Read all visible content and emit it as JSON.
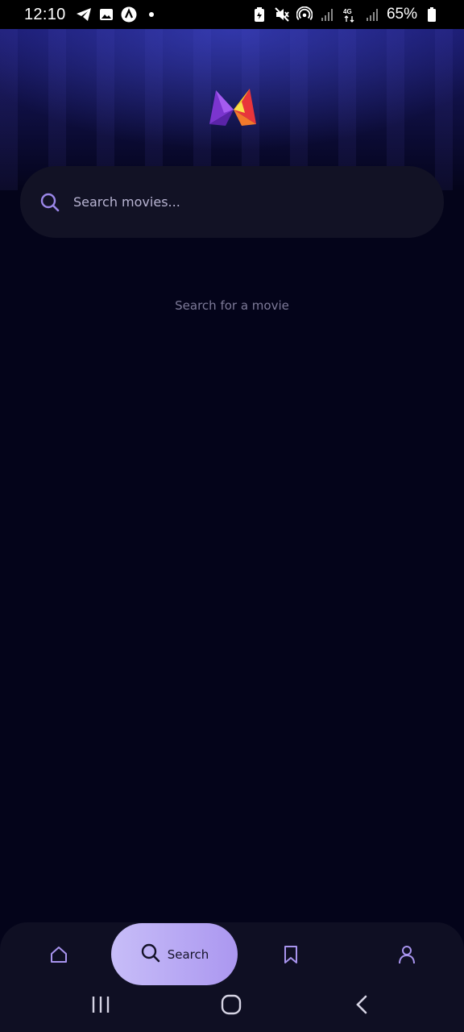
{
  "status_bar": {
    "time": "12:10",
    "battery": "65%",
    "left_icons": [
      "telegram-icon",
      "gallery-icon",
      "app-icon",
      "dot-icon"
    ],
    "right_icons": [
      "battery-saver-icon",
      "mute-icon",
      "hotspot-icon",
      "signal-icon",
      "4g-icon",
      "signal-icon"
    ]
  },
  "colors": {
    "background": "#04041a",
    "search_bar": "#121225",
    "accent": "#b9a6f5",
    "logo_purple": "#8a3fd6",
    "logo_yellow": "#f7d21e",
    "logo_red": "#e8353b"
  },
  "search": {
    "placeholder": "Search movies...",
    "value": ""
  },
  "empty_state": {
    "message": "Search for a movie"
  },
  "bottom_nav": {
    "items": [
      {
        "icon": "home-icon",
        "label": "",
        "active": false
      },
      {
        "icon": "search-icon",
        "label": "Search",
        "active": true
      },
      {
        "icon": "bookmark-icon",
        "label": "",
        "active": false
      },
      {
        "icon": "profile-icon",
        "label": "",
        "active": false
      }
    ]
  },
  "system_nav": {
    "buttons": [
      "recents-icon",
      "home-circle-icon",
      "back-icon"
    ]
  }
}
